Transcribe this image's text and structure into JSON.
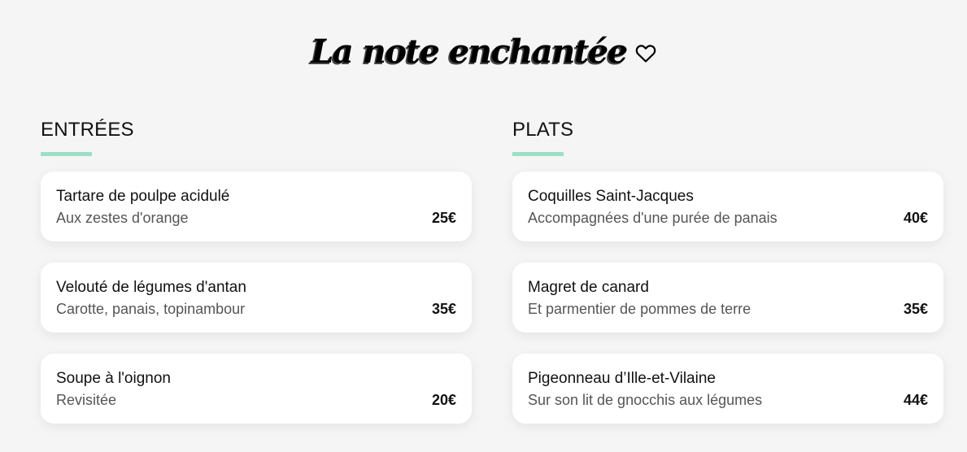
{
  "header": {
    "title": "La note enchantée"
  },
  "columns": [
    {
      "heading": "ENTRÉES",
      "items": [
        {
          "name": "Tartare de poulpe acidulé",
          "description": "Aux zestes d'orange",
          "price": "25€"
        },
        {
          "name": "Velouté de légumes d'antan",
          "description": "Carotte, panais, topinambour",
          "price": "35€"
        },
        {
          "name": "Soupe à l'oignon",
          "description": "Revisitée",
          "price": "20€"
        }
      ]
    },
    {
      "heading": "PLATS",
      "items": [
        {
          "name": "Coquilles Saint-Jacques",
          "description": "Accompagnées d'une purée de panais",
          "price": "40€"
        },
        {
          "name": "Magret de canard",
          "description": "Et parmentier de pommes de terre",
          "price": "35€"
        },
        {
          "name": "Pigeonneau d’Ille-et-Vilaine",
          "description": "Sur son lit de gnocchis aux légumes",
          "price": "44€"
        }
      ]
    }
  ],
  "colors": {
    "background": "#f5f5f5",
    "card": "#ffffff",
    "accent_underline": "#9be0c6"
  },
  "icons": {
    "title_icon": "heart-outline-icon"
  }
}
